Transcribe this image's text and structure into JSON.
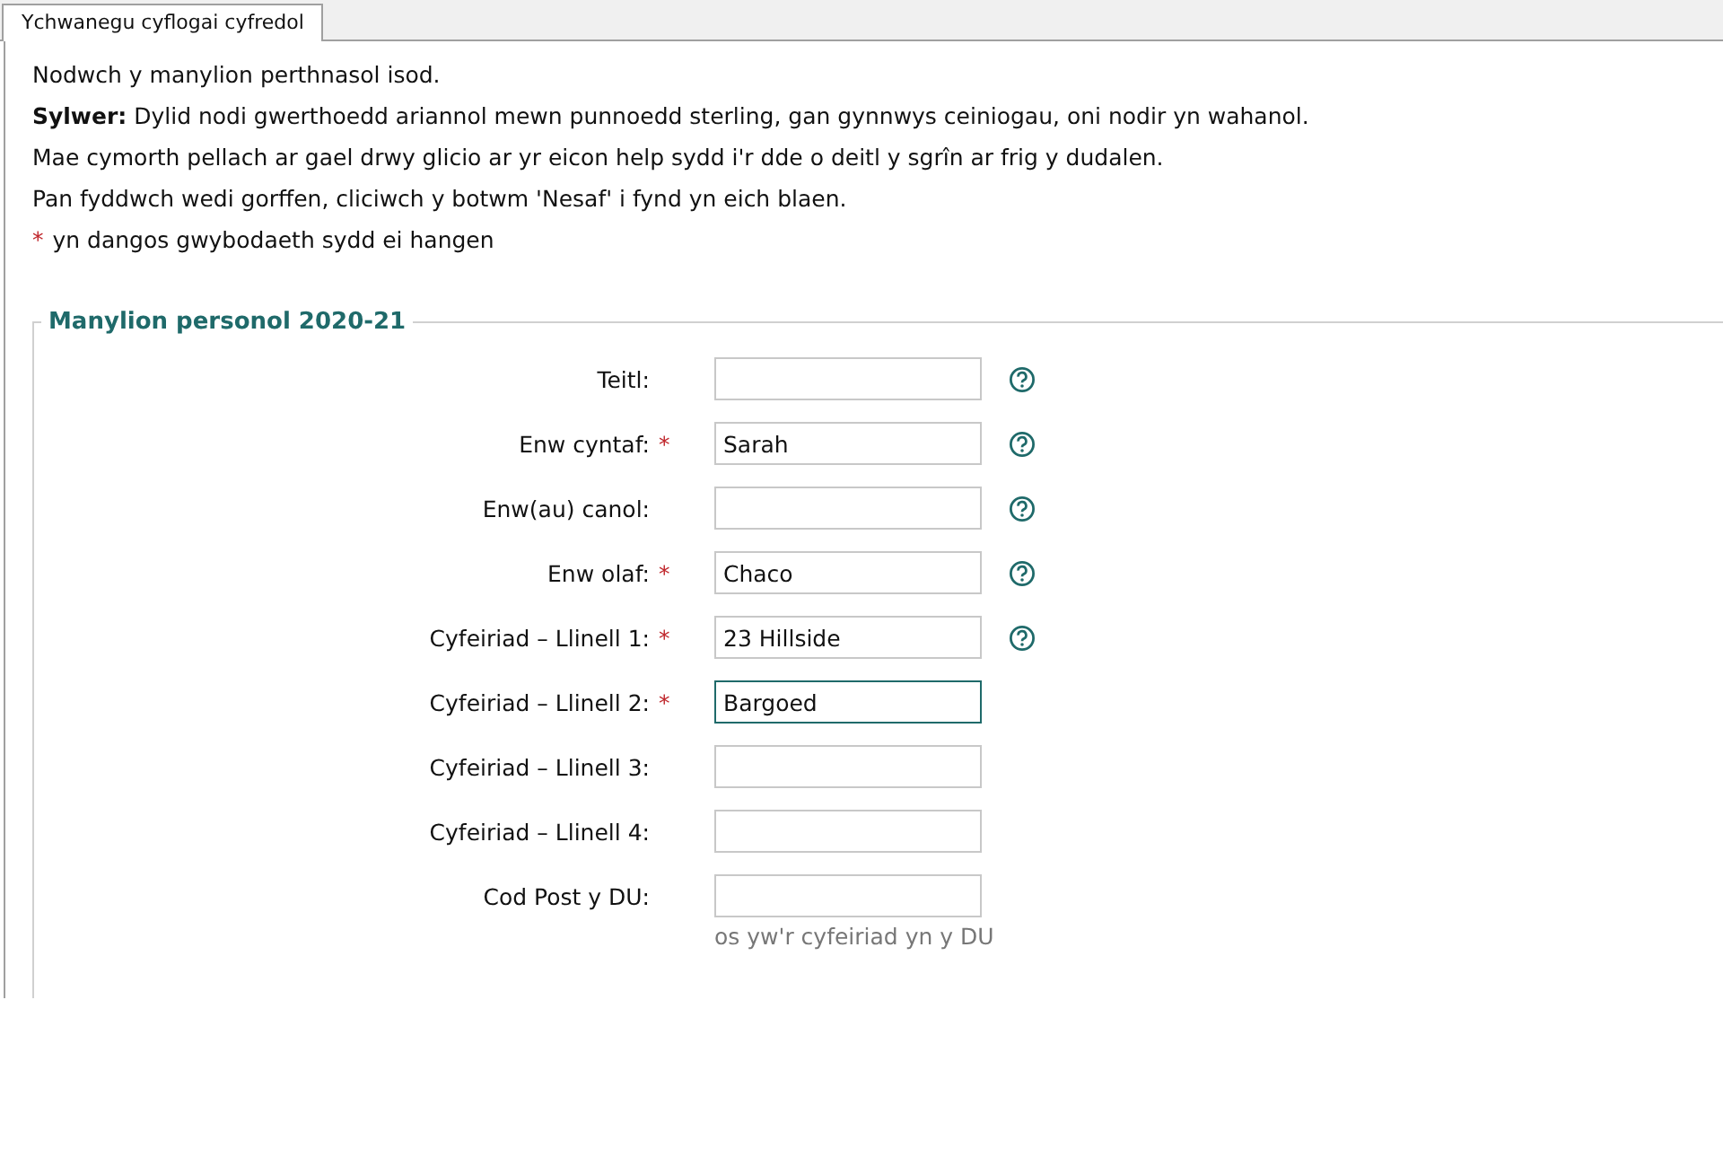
{
  "tabs": [
    {
      "label": "Ychwanegu cyflogai cyfredol",
      "selected": true
    }
  ],
  "intro": [
    "Nodwch y manylion perthnasol isod.",
    "**Sylwer:** Dylid nodi gwerthoedd ariannol mewn punnoedd sterling, gan gynnwys ceiniogau, oni nodir yn wahanol.",
    "Mae cymorth pellach ar gael drwy glicio ar yr eicon help sydd i'r dde o deitl y sgrîn ar frig y dudalen.",
    "Pan fyddwch wedi gorffen, cliciwch y botwm 'Nesaf' i fynd yn eich blaen."
  ],
  "required_note": {
    "mark": "*",
    "text": "yn dangos gwybodaeth sydd ei hangen"
  },
  "fieldset": {
    "legend": "Manylion personol 2020-21",
    "fields": [
      {
        "label": "Teitl:",
        "required": false,
        "help": true,
        "focused": false
      },
      {
        "label": "Enw cyntaf:",
        "required": true,
        "value": "Sarah",
        "help": true,
        "focused": false
      },
      {
        "label": "Enw(au) canol:",
        "required": false,
        "help": true,
        "focused": false
      },
      {
        "label": "Enw olaf:",
        "required": true,
        "value": "Chaco",
        "help": true,
        "focused": false
      },
      {
        "label": "Cyfeiriad – Llinell 1:",
        "required": true,
        "value": "23 Hillside",
        "help": true,
        "focused": false
      },
      {
        "label": "Cyfeiriad – Llinell 2:",
        "required": true,
        "value": "Bargoed",
        "help": false,
        "focused": true
      },
      {
        "label": "Cyfeiriad – Llinell 3:",
        "required": false,
        "help": false,
        "focused": false
      },
      {
        "label": "Cyfeiriad – Llinell 4:",
        "required": false,
        "help": false,
        "focused": false
      },
      {
        "label": "Cod Post y DU:",
        "required": false,
        "help": false,
        "focused": false,
        "hint": "os yw'r cyfeiriad yn y DU"
      }
    ]
  }
}
